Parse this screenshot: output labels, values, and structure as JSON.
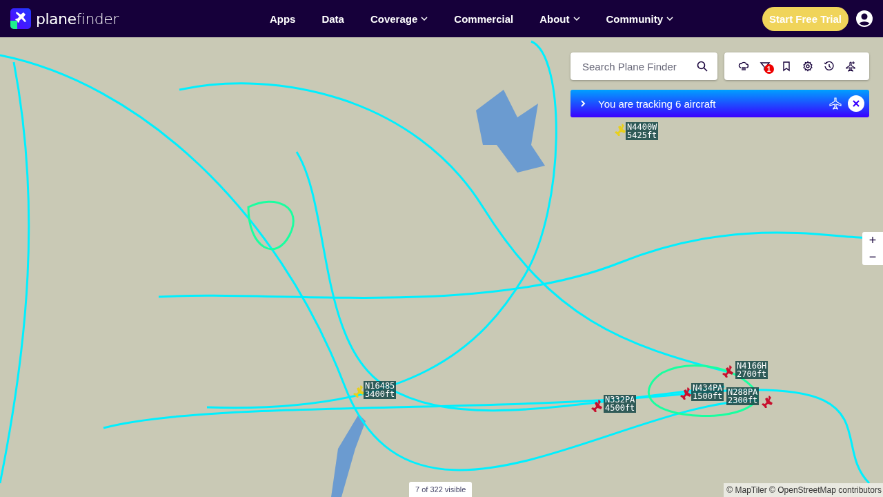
{
  "header": {
    "logo": "**plane**finder",
    "nav": [
      {
        "label": "Apps",
        "dropdown": false
      },
      {
        "label": "Data",
        "dropdown": false
      },
      {
        "label": "Coverage",
        "dropdown": true
      },
      {
        "label": "Commercial",
        "dropdown": false
      },
      {
        "label": "About",
        "dropdown": true
      },
      {
        "label": "Community",
        "dropdown": true
      }
    ],
    "cta": "Start Free Trial"
  },
  "search": {
    "placeholder": "Search Plane Finder"
  },
  "toolbar": [
    {
      "kind": "weather"
    },
    {
      "kind": "filter",
      "badge": "1"
    },
    {
      "kind": "bookmark"
    },
    {
      "kind": "settings"
    },
    {
      "kind": "history"
    },
    {
      "kind": "add-aircraft"
    }
  ],
  "tracking_banner": {
    "text": "You are tracking 6 aircraft"
  },
  "aircraft": [
    {
      "callsign": "N4400W",
      "altitude": "5425ft",
      "color": "#e8d01c"
    },
    {
      "callsign": "N16485",
      "altitude": "3400ft",
      "color": "#e8d01c"
    },
    {
      "callsign": "N332PA",
      "altitude": "4500ft",
      "color": "#c8102e"
    },
    {
      "callsign": "N434PA",
      "altitude": "1500ft",
      "color": "#c8102e"
    },
    {
      "callsign": "N4166H",
      "altitude": "2700ft",
      "color": "#c8102e"
    },
    {
      "callsign": "N288PA",
      "altitude": "2300ft",
      "color": "#c8102e"
    }
  ],
  "zoom_controls": {
    "in": "+",
    "out": "−"
  },
  "visible_count": "7 of 322 visible",
  "attribution": "© MapTiler © OpenStreetMap contributors"
}
